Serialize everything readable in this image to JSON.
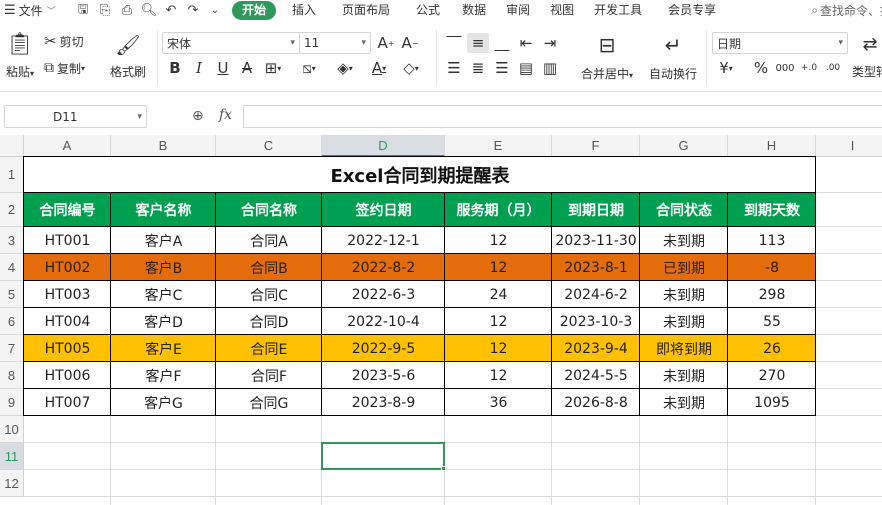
{
  "menu": {
    "file_label": "文件",
    "tabs": [
      "开始",
      "插入",
      "页面布局",
      "公式",
      "数据",
      "审阅",
      "视图",
      "开发工具",
      "会员专享"
    ],
    "active_tab": "开始",
    "search_text": "查找命令、搜"
  },
  "ribbon": {
    "paste": "粘贴",
    "cut": "剪切",
    "copy": "复制",
    "format_painter": "格式刷",
    "font_name": "宋体",
    "font_size": "11",
    "merge_center": "合并居中",
    "wrap_text": "自动换行",
    "number_format": "日期",
    "type_convert": "类型转"
  },
  "formula_bar": {
    "name_box": "D11",
    "fx": "fx",
    "formula": ""
  },
  "columns": [
    "A",
    "B",
    "C",
    "D",
    "E",
    "F",
    "G",
    "H",
    "I"
  ],
  "selected_column": "D",
  "rows": [
    "1",
    "2",
    "3",
    "4",
    "5",
    "6",
    "7",
    "8",
    "9",
    "10",
    "11",
    "12"
  ],
  "selected_row": "11",
  "sheet": {
    "title": "Excel合同到期提醒表",
    "headers": [
      "合同编号",
      "客户名称",
      "合同名称",
      "签约日期",
      "服务期（月）",
      "到期日期",
      "合同状态",
      "到期天数"
    ],
    "records": [
      [
        "HT001",
        "客户A",
        "合同A",
        "2022-12-1",
        "12",
        "2023-11-30",
        "未到期",
        "113"
      ],
      [
        "HT002",
        "客户B",
        "合同B",
        "2022-8-2",
        "12",
        "2023-8-1",
        "已到期",
        "-8"
      ],
      [
        "HT003",
        "客户C",
        "合同C",
        "2022-6-3",
        "24",
        "2024-6-2",
        "未到期",
        "298"
      ],
      [
        "HT004",
        "客户D",
        "合同D",
        "2022-10-4",
        "12",
        "2023-10-3",
        "未到期",
        "55"
      ],
      [
        "HT005",
        "客户E",
        "合同E",
        "2022-9-5",
        "12",
        "2023-9-4",
        "即将到期",
        "26"
      ],
      [
        "HT006",
        "客户F",
        "合同F",
        "2023-5-6",
        "12",
        "2024-5-5",
        "未到期",
        "270"
      ],
      [
        "HT007",
        "客户G",
        "合同G",
        "2023-8-9",
        "36",
        "2026-8-8",
        "未到期",
        "1095"
      ]
    ],
    "status_colors": {
      "已到期": "#e46c0a",
      "即将到期": "#ffc000"
    },
    "header_color": "#00a050"
  },
  "accent_color": "#2d9a5c"
}
